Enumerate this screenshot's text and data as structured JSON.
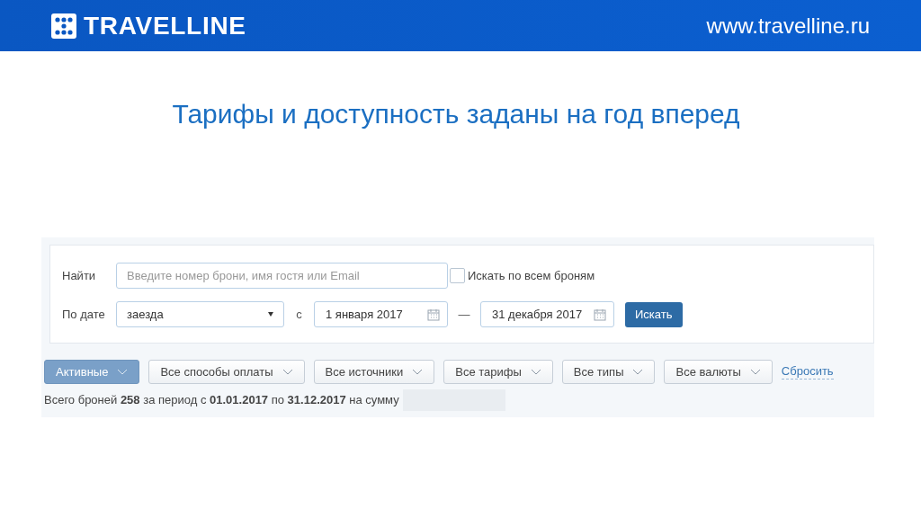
{
  "header": {
    "logo": "TRAVELLINE",
    "url": "www.travelline.ru"
  },
  "title": "Тарифы и доступность заданы на год вперед",
  "search": {
    "find_label": "Найти",
    "placeholder": "Введите номер брони, имя гостя или Email",
    "all_bookings": {
      "label": "Искать по всем броням",
      "checked": false
    },
    "date_label": "По дате",
    "date_type": "заезда",
    "from_label": "с",
    "from": "1 января 2017",
    "dash": "—",
    "to": "31 декабря 2017",
    "button": "Искать"
  },
  "filters": [
    {
      "label": "Активные",
      "selected": true
    },
    {
      "label": "Все способы оплаты",
      "selected": false
    },
    {
      "label": "Все источники",
      "selected": false
    },
    {
      "label": "Все тарифы",
      "selected": false
    },
    {
      "label": "Все типы",
      "selected": false
    },
    {
      "label": "Все валюты",
      "selected": false
    }
  ],
  "reset": "Сбросить",
  "summary": "Всего броней **258** за период с **01.01.2017** по **31.12.2017** на сумму"
}
